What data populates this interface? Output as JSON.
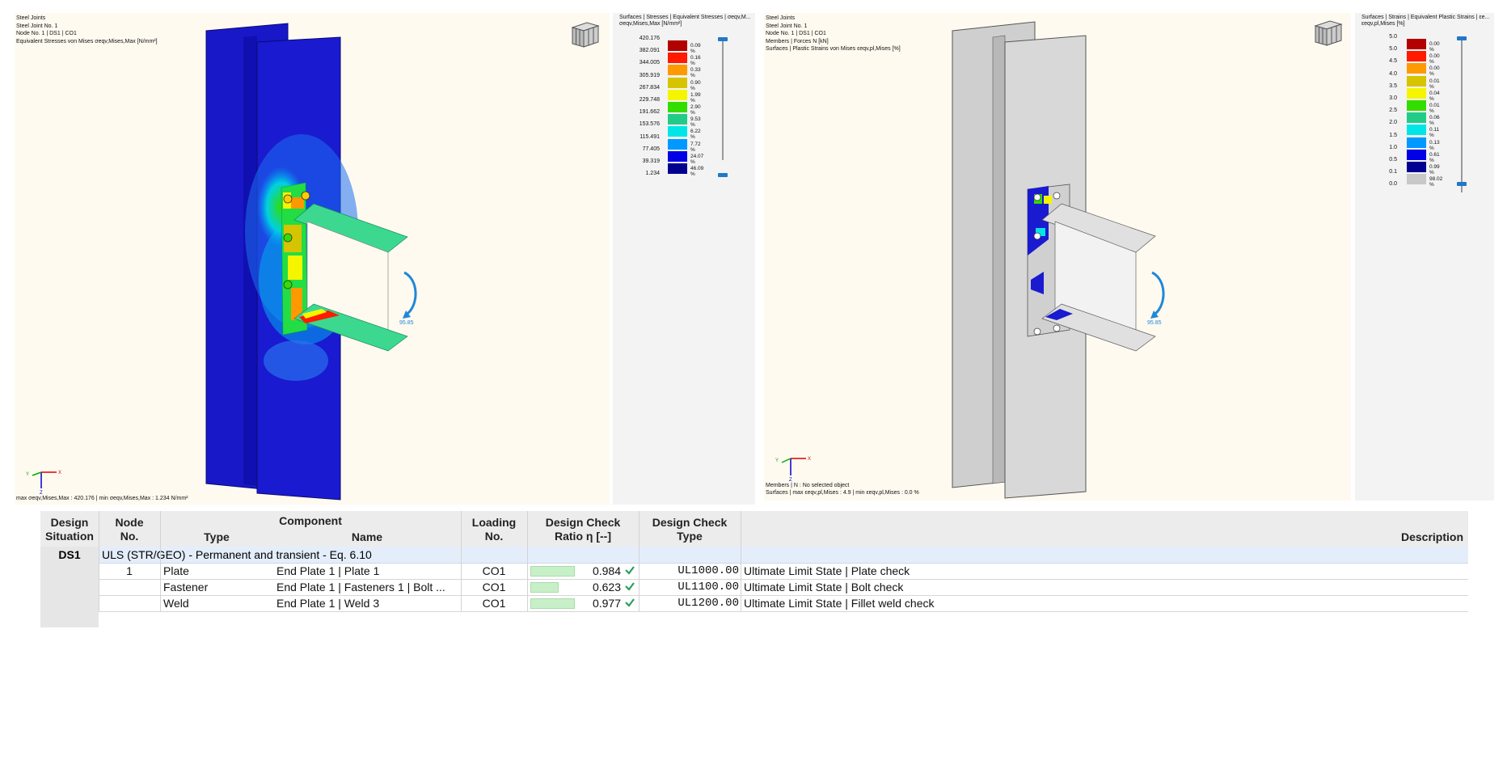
{
  "left_view": {
    "header": [
      "Steel Joints",
      "Steel Joint No. 1",
      "Node No. 1 | DS1 | CO1",
      "Equivalent Stresses von Mises σeqv,Mises,Max [N/mm²]"
    ],
    "footer": "max σeqv,Mises,Max : 420.176 | min σeqv,Mises,Max : 1.234 N/mm²",
    "moment_label": "95.85",
    "axis_labels": {
      "x": "X",
      "y": "Y",
      "z": "Z"
    },
    "legend": {
      "title": "Surfaces | Stresses | Equivalent Stresses | σeqv,M...",
      "subtitle": "σeqv,Mises,Max [N/mm²]",
      "values": [
        "420.176",
        "382.091",
        "344.005",
        "305.919",
        "267.834",
        "229.748",
        "191.662",
        "153.576",
        "115.491",
        "77.405",
        "39.319",
        "1.234"
      ],
      "entries": [
        {
          "pct": "0.09 %",
          "color": "#b30000"
        },
        {
          "pct": "0.16 %",
          "color": "#ff1a00"
        },
        {
          "pct": "0.33 %",
          "color": "#ff9900"
        },
        {
          "pct": "0.90 %",
          "color": "#d6c400"
        },
        {
          "pct": "1.99 %",
          "color": "#f5f500"
        },
        {
          "pct": "2.90 %",
          "color": "#33dd00"
        },
        {
          "pct": "9.53 %",
          "color": "#22cc88"
        },
        {
          "pct": "6.22 %",
          "color": "#00e6e6"
        },
        {
          "pct": "7.72 %",
          "color": "#0099ff"
        },
        {
          "pct": "24.07 %",
          "color": "#0000e6"
        },
        {
          "pct": "46.09 %",
          "color": "#000090"
        }
      ]
    }
  },
  "right_view": {
    "header": [
      "Steel Joints",
      "Steel Joint No. 1",
      "Node No. 1 | DS1 | CO1",
      "Members | Forces N [kN]",
      "Surfaces | Plastic Strains von Mises εeqv,pl,Mises [%]"
    ],
    "footer": [
      "Members | N : No selected object",
      "Surfaces | max εeqv,pl,Mises : 4.9 | min εeqv,pl,Mises : 0.0 %"
    ],
    "moment_label": "95.85",
    "axis_labels": {
      "x": "X",
      "y": "Y",
      "z": "Z"
    },
    "legend": {
      "title": "Surfaces | Strains | Equivalent Plastic Strains | εe...",
      "subtitle": "εeqv,pl,Mises [%]",
      "values": [
        "5.0",
        "5.0",
        "4.5",
        "4.0",
        "3.5",
        "3.0",
        "2.5",
        "2.0",
        "1.5",
        "1.0",
        "0.5",
        "0.1",
        "0.0"
      ],
      "entries": [
        {
          "pct": "0.00 %",
          "color": "#b30000"
        },
        {
          "pct": "0.00 %",
          "color": "#ff1a00"
        },
        {
          "pct": "0.00 %",
          "color": "#ff9900"
        },
        {
          "pct": "0.01 %",
          "color": "#d6c400"
        },
        {
          "pct": "0.04 %",
          "color": "#f5f500"
        },
        {
          "pct": "0.01 %",
          "color": "#33dd00"
        },
        {
          "pct": "0.06 %",
          "color": "#22cc88"
        },
        {
          "pct": "0.11 %",
          "color": "#00e6e6"
        },
        {
          "pct": "0.13 %",
          "color": "#0099ff"
        },
        {
          "pct": "0.61 %",
          "color": "#0000e6"
        },
        {
          "pct": "0.99 %",
          "color": "#000090"
        },
        {
          "pct": "98.02 %",
          "color": "#c8c8c8"
        }
      ]
    }
  },
  "table": {
    "headers": {
      "design_situation": [
        "Design",
        "Situation"
      ],
      "node_no": [
        "Node",
        "No."
      ],
      "component": "Component",
      "type": "Type",
      "name": "Name",
      "loading_no": [
        "Loading",
        "No."
      ],
      "ratio": [
        "Design Check",
        "Ratio η [--]"
      ],
      "check_type": [
        "Design Check",
        "Type"
      ],
      "description": "Description"
    },
    "group": {
      "ds": "DS1",
      "label": "ULS (STR/GEO) - Permanent and transient - Eq. 6.10"
    },
    "rows": [
      {
        "node": "1",
        "type": "Plate",
        "name": "End Plate 1 | Plate 1",
        "loading": "CO1",
        "ratio": "0.984",
        "ratio_value": 0.984,
        "check": "UL1000.00",
        "description": "Ultimate Limit State | Plate check"
      },
      {
        "node": "",
        "type": "Fastener",
        "name": "End Plate 1 | Fasteners 1 | Bolt ...",
        "loading": "CO1",
        "ratio": "0.623",
        "ratio_value": 0.623,
        "check": "UL1100.00",
        "description": "Ultimate Limit State | Bolt check"
      },
      {
        "node": "",
        "type": "Weld",
        "name": "End Plate 1 | Weld 3",
        "loading": "CO1",
        "ratio": "0.977",
        "ratio_value": 0.977,
        "check": "UL1200.00",
        "description": "Ultimate Limit State | Fillet weld check"
      }
    ]
  },
  "colors": {
    "check_ok": "#2a9d5c",
    "ratio_bar": "#c8f0c8",
    "column_blue": "#1010c8"
  }
}
